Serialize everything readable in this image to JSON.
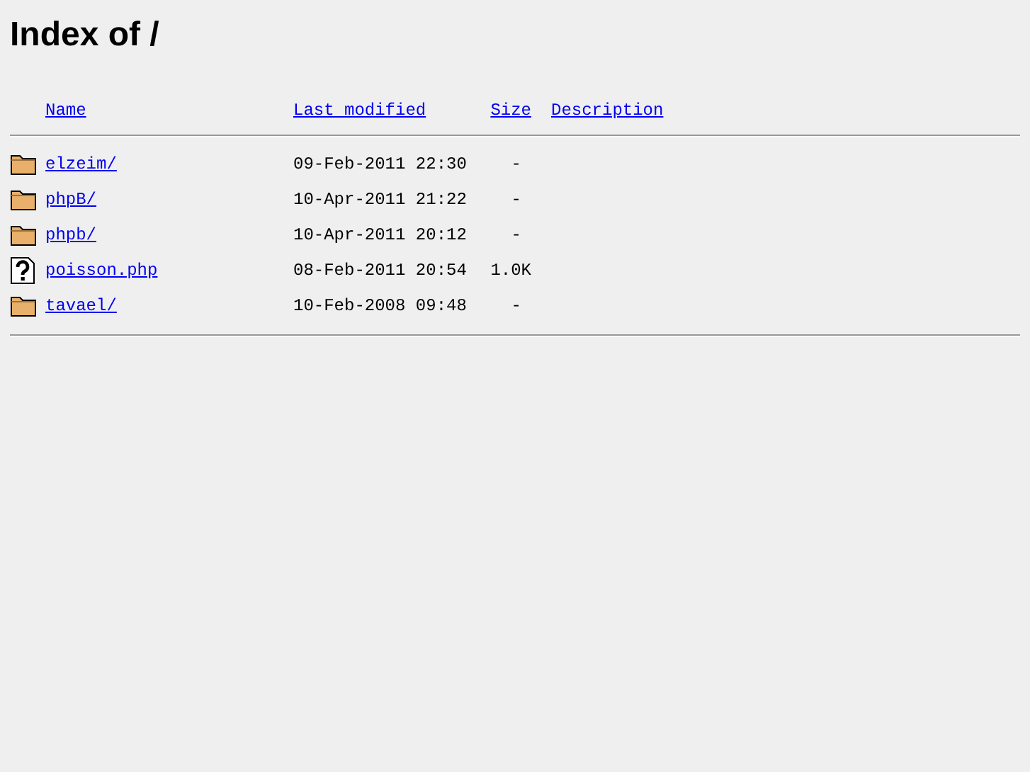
{
  "title": "Index of /",
  "columns": [
    "Name",
    "Last modified",
    "Size",
    "Description"
  ],
  "rows": [
    {
      "kind": "folder",
      "name": "elzeim/",
      "modified": "09-Feb-2011 22:30",
      "size": "-"
    },
    {
      "kind": "folder",
      "name": "phpB/",
      "modified": "10-Apr-2011 21:22",
      "size": "-"
    },
    {
      "kind": "folder",
      "name": "phpb/",
      "modified": "10-Apr-2011 20:12",
      "size": "-"
    },
    {
      "kind": "unknown",
      "name": "poisson.php",
      "modified": "08-Feb-2011 20:54",
      "size": "1.0K"
    },
    {
      "kind": "folder",
      "name": "tavael/",
      "modified": "10-Feb-2008 09:48",
      "size": "-"
    }
  ]
}
